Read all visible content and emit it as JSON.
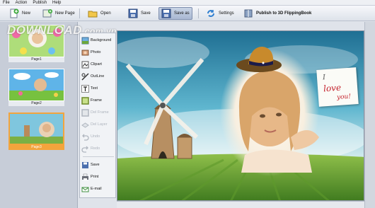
{
  "menu": {
    "items": [
      "File",
      "Action",
      "Publish",
      "Help"
    ]
  },
  "toolbar": {
    "new": "New",
    "new_page": "New Page",
    "open": "Open",
    "save": "Save",
    "save_as": "Save as",
    "settings": "Settings",
    "publish": "Publish to 3D FlippingBook"
  },
  "pages": [
    {
      "label": "Page1",
      "selected": false
    },
    {
      "label": "Page2",
      "selected": false
    },
    {
      "label": "Page3",
      "selected": true
    }
  ],
  "tools": {
    "background": "Background",
    "photo": "Photo",
    "clipart": "Clipart",
    "outline": "OutLine",
    "text": "Text",
    "frame": "Frame",
    "del_frame": "Del Frame",
    "del_layer": "Del Layer",
    "undo": "Undo",
    "redo": "Redo",
    "save": "Save",
    "print": "Print",
    "email": "E-mail"
  },
  "watermark": {
    "main": "DOWNLOAD",
    "suffix": ".com.vn"
  },
  "canvas": {
    "note_line1": "I",
    "note_line2": "love",
    "note_line3": "you!"
  },
  "colors": {
    "selected_page": "#f4a43c",
    "sky": "#3aa3c6",
    "grass": "#6ea83a"
  }
}
